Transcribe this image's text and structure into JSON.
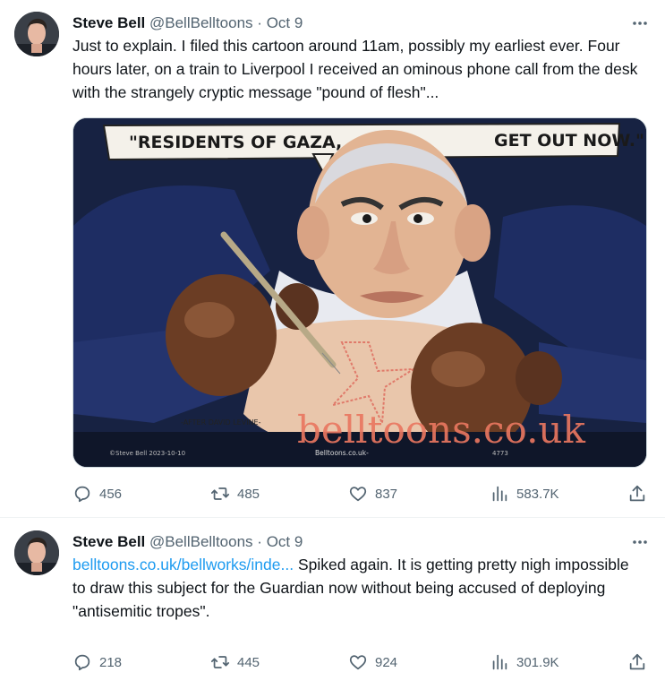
{
  "tweets": [
    {
      "author": {
        "name": "Steve Bell",
        "handle": "@BellBelltoons",
        "separator": "·",
        "date": "Oct 9"
      },
      "text": "Just to explain. I filed this cartoon around 11am, possibly my earliest ever. Four hours later, on a train to Liverpool I received an ominous phone call from the desk with the strangely cryptic message \"pound of flesh\"...",
      "media": {
        "speech_left": "\"RESIDENTS OF GAZA,",
        "speech_right": "GET OUT NOW.\"",
        "watermark": "belltoons.co.uk",
        "caption_credit": "-AFTER DAVID LEVINE-",
        "caption_site": "Belltoons.co.uk-",
        "caption_signature": "©Steve Bell 2023-10-10",
        "caption_number": "4773"
      },
      "stats": {
        "replies": "456",
        "reposts": "485",
        "likes": "837",
        "views": "583.7K"
      }
    },
    {
      "author": {
        "name": "Steve Bell",
        "handle": "@BellBelltoons",
        "separator": "·",
        "date": "Oct 9"
      },
      "link": "belltoons.co.uk/bellworks/inde...",
      "text": " Spiked again. It is getting pretty nigh impossible to draw this subject for the Guardian now without being accused of deploying \"antisemitic tropes\".",
      "stats": {
        "replies": "218",
        "reposts": "445",
        "likes": "924",
        "views": "301.9K"
      }
    }
  ],
  "icons": {
    "reply": "speech-bubble-icon",
    "repost": "repost-arrows-icon",
    "like": "heart-icon",
    "views": "bar-chart-icon",
    "share": "share-upload-icon",
    "more": "more-dots-icon"
  },
  "colors": {
    "link": "#1d9bf0",
    "secondary_text": "#536471",
    "primary_text": "#0f1419",
    "divider": "#eff3f4"
  }
}
